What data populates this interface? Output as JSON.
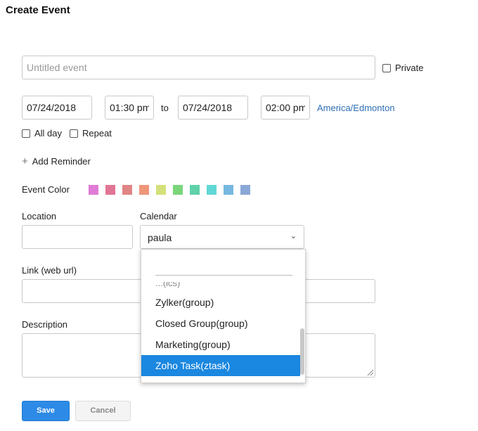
{
  "title": "Create Event",
  "event": {
    "title_placeholder": "Untitled event",
    "private_label": "Private",
    "start_date": "07/24/2018",
    "start_time": "01:30 pm",
    "to_label": "to",
    "end_date": "07/24/2018",
    "end_time": "02:00 pm",
    "timezone": "America/Edmonton",
    "allday_label": "All day",
    "repeat_label": "Repeat",
    "add_reminder_label": "Add Reminder"
  },
  "color": {
    "label": "Event Color",
    "swatches": [
      "#e07bd6",
      "#e27595",
      "#e08585",
      "#f0967b",
      "#d4e07b",
      "#7bd67b",
      "#5fd1a8",
      "#62d8d6",
      "#76b8e0",
      "#8aa8d6"
    ]
  },
  "location": {
    "label": "Location",
    "value": ""
  },
  "calendar": {
    "label": "Calendar",
    "selected": "paula",
    "partial_item": "...(ics)",
    "options": [
      "Zylker(group)",
      "Closed Group(group)",
      "Marketing(group)",
      "Zoho Task(ztask)"
    ],
    "highlighted_index": 3
  },
  "link": {
    "label": "Link (web url)",
    "value": ""
  },
  "description": {
    "label": "Description",
    "value": ""
  },
  "actions": {
    "save_label": "Save",
    "cancel_label": "Cancel"
  },
  "icons": {
    "plus": "plus-icon",
    "chevron": "chevron-down-icon",
    "checkbox": "checkbox-icon"
  },
  "accent_colors": {
    "primary": "#2d8ae6",
    "link": "#2d6fb3",
    "highlight": "#1a87e0"
  }
}
